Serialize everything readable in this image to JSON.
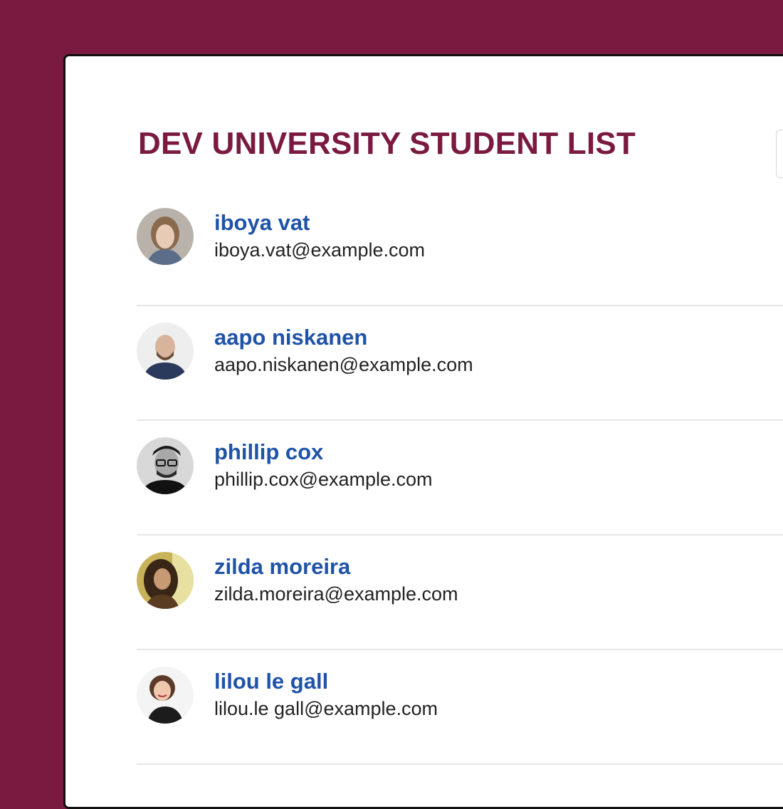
{
  "page": {
    "title": "DEV UNIVERSITY STUDENT LIST",
    "background_color": "#7a1a40",
    "name_color": "#1f53a8"
  },
  "students": [
    {
      "name": "iboya vat",
      "email": "iboya.vat@example.com",
      "avatar": "woman-portrait-light"
    },
    {
      "name": "aapo niskanen",
      "email": "aapo.niskanen@example.com",
      "avatar": "bald-man-portrait"
    },
    {
      "name": "phillip cox",
      "email": "phillip.cox@example.com",
      "avatar": "man-glasses-portrait-bw"
    },
    {
      "name": "zilda moreira",
      "email": "zilda.moreira@example.com",
      "avatar": "woman-portrait-warm"
    },
    {
      "name": "lilou le gall",
      "email": "lilou.le gall@example.com",
      "avatar": "woman-portrait-smiling"
    }
  ]
}
